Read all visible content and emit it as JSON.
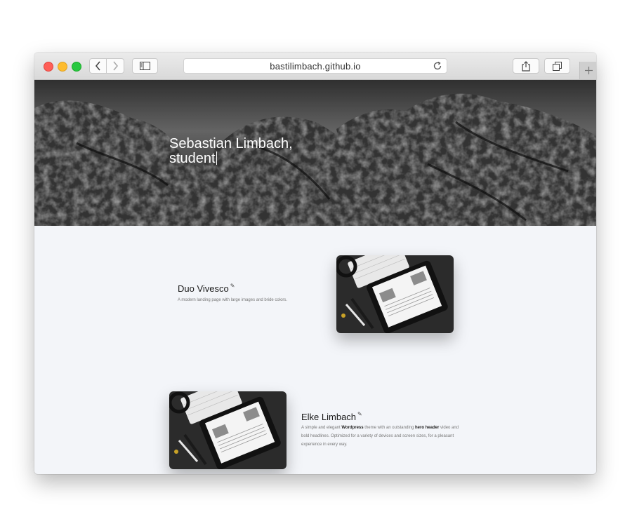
{
  "browser": {
    "url": "bastilimbach.github.io",
    "icons": {
      "back": "chevron-left-icon",
      "forward": "chevron-right-icon",
      "sidebar": "sidebar-icon",
      "reload": "reload-icon",
      "share": "share-icon",
      "tabs": "tabs-overview-icon",
      "new_tab": "plus-icon"
    }
  },
  "hero": {
    "title_line1": "Sebastian Limbach,",
    "title_line2": "student"
  },
  "projects": [
    {
      "title": "Duo Vivesco",
      "edit_icon": "pencil-icon",
      "description": "A modern landing page with large images and bride colors."
    },
    {
      "title": "Elke Limbach",
      "edit_icon": "pencil-icon",
      "desc_p1": "A simple and elegant ",
      "desc_b1": "Wordpress",
      "desc_p2": " theme with an outstanding ",
      "desc_b2": "hero header",
      "desc_p3": " video and bold headlines. Optimized for a variety of devices and screen sizes, for a pleasant experience in every way."
    }
  ],
  "colors": {
    "page_bg": "#f3f5f9",
    "traffic_red": "#ff5f57",
    "traffic_yellow": "#febc2e",
    "traffic_green": "#28c840"
  }
}
